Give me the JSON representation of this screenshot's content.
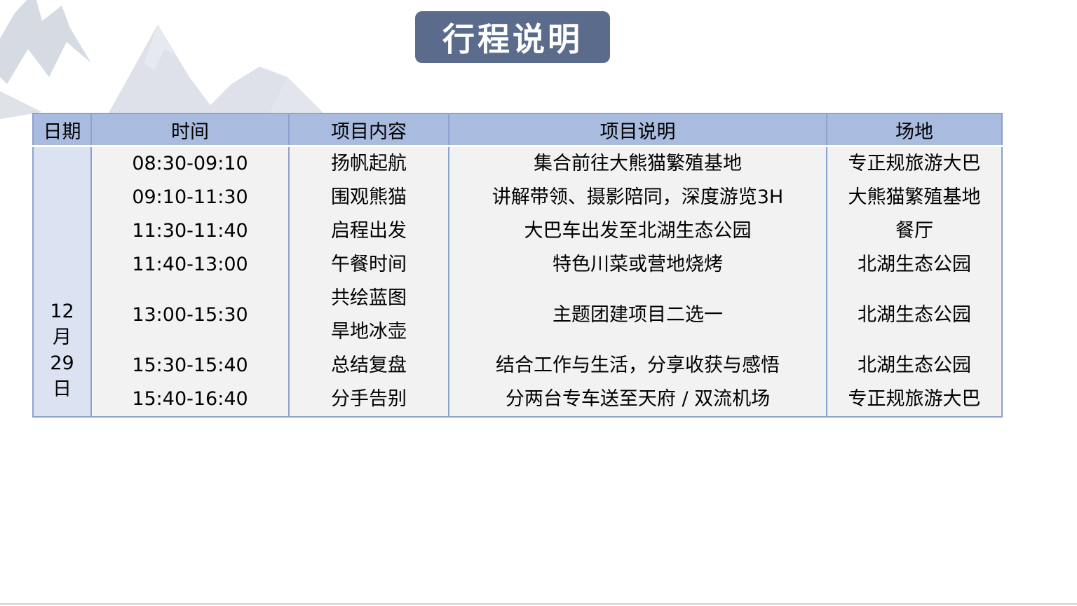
{
  "title": "行程说明",
  "table": {
    "headers": [
      "日期",
      "时间",
      "项目内容",
      "项目说明",
      "场地"
    ],
    "date": [
      "12",
      "月",
      "29",
      "日"
    ],
    "rows": [
      {
        "time": "08:30-09:10",
        "item": "扬帆起航",
        "desc": "集合前往大熊猫繁殖基地",
        "venue": "专正规旅游大巴"
      },
      {
        "time": "09:10-11:30",
        "item": "围观熊猫",
        "desc": "讲解带领、摄影陪同，深度游览3H",
        "venue": "大熊猫繁殖基地"
      },
      {
        "time": "11:30-11:40",
        "item": "启程出发",
        "desc": "大巴车出发至北湖生态公园",
        "venue": "餐厅"
      },
      {
        "time": "11:40-13:00",
        "item": "午餐时间",
        "desc": "特色川菜或营地烧烤",
        "venue": "北湖生态公园"
      },
      {
        "time": "13:00-15:30",
        "item_lines": [
          "共绘蓝图",
          "旱地冰壶"
        ],
        "desc": "主题团建项目二选一",
        "venue": "北湖生态公园"
      },
      {
        "time": "15:30-15:40",
        "item": "总结复盘",
        "desc": "结合工作与生活，分享收获与感悟",
        "venue": "北湖生态公园"
      },
      {
        "time": "15:40-16:40",
        "item": "分手告别",
        "desc": "分两台专车送至天府 / 双流机场",
        "venue": "专正规旅游大巴"
      }
    ]
  },
  "colors": {
    "title_bg": "#5b6b8c",
    "header_bg": "#a9bce0",
    "date_bg": "#dbe2f1",
    "cell_bg": "#f2f2f2",
    "border": "#8da2cf"
  }
}
